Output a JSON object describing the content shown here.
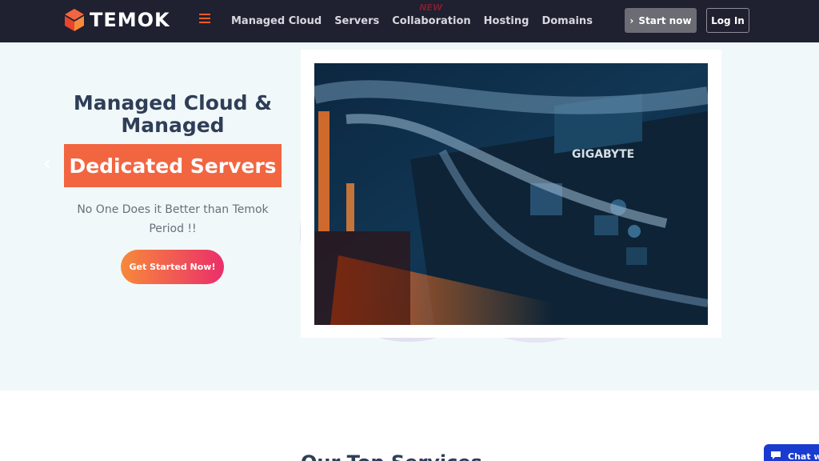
{
  "nav": {
    "logo_text": "TEMOK",
    "menu": [
      {
        "label": "Managed Cloud"
      },
      {
        "label": "Servers"
      },
      {
        "label": "Collaboration",
        "badge": "NEW"
      },
      {
        "label": "Hosting"
      },
      {
        "label": "Domains"
      }
    ],
    "start_label": "Start now",
    "login_label": "Log In"
  },
  "hero": {
    "title_line1": "Managed Cloud &",
    "title_line2": "Managed",
    "highlight": "Dedicated Servers",
    "sub_line1": "No One Does it Better than Temok",
    "sub_line2": "Period !!",
    "cta_label": "Get Started Now!",
    "photo_brand": "GIGABYTE"
  },
  "section": {
    "heading": "Our Top Services"
  },
  "chat": {
    "label": "Chat w"
  },
  "colors": {
    "nav_bg": "#1f2030",
    "accent": "#f26541",
    "hero_bg": "#f1f8fa",
    "chat": "#1a3bd0"
  }
}
